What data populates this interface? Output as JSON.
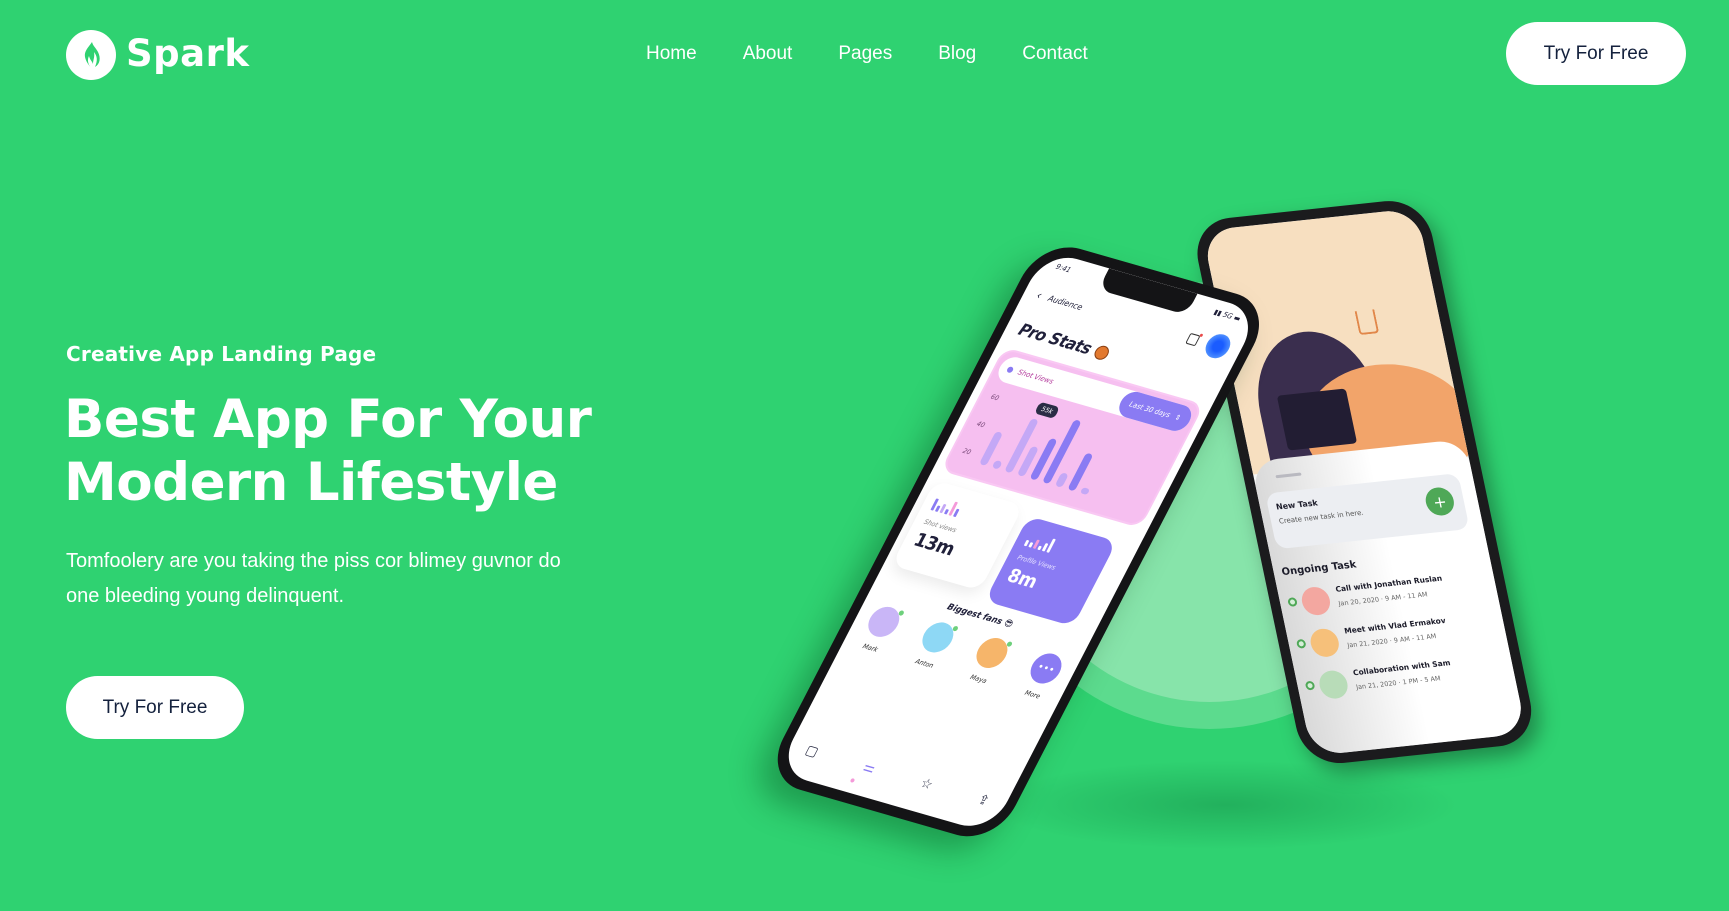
{
  "brand": {
    "name": "Spark",
    "logo_icon": "flame-icon",
    "colors": {
      "background": "#2fd271",
      "halo_outer": "#5cdb8e",
      "halo_inner": "#87e4aa",
      "button_bg": "#ffffff",
      "button_text": "#14213d",
      "accent_purple": "#8a7bf3",
      "chart_pink": "#f6bff0",
      "task_green": "#4fa857"
    }
  },
  "nav": {
    "items": [
      {
        "label": "Home"
      },
      {
        "label": "About"
      },
      {
        "label": "Pages"
      },
      {
        "label": "Blog"
      },
      {
        "label": "Contact"
      }
    ],
    "cta_label": "Try For Free"
  },
  "hero": {
    "eyebrow": "Creative App Landing Page",
    "headline_line1": "Best App For Your",
    "headline_line2": "Modern Lifestyle",
    "lead": "Tomfoolery are you taking the piss cor blimey guvnor do one bleeding young delinquent.",
    "cta_label": "Try For Free"
  },
  "mockup_front": {
    "status_time": "9:41",
    "status_right": "5G",
    "back_icon": "chevron-left-icon",
    "topbar_title": "Audience",
    "calendar_icon": "calendar-icon",
    "page_title": "Pro Stats",
    "title_emoji": "basketball-icon",
    "chart": {
      "label": "Shot Views",
      "range_label": "Last 30 days",
      "range_icon": "updown-chevron-icon",
      "y_ticks": [
        "60",
        "40",
        "20"
      ],
      "tooltip": "55k",
      "bar_values": [
        0.45,
        0.1,
        0.72,
        0.4,
        0.55,
        0.85,
        0.18,
        0.5,
        0.08
      ],
      "bar_light": [
        true,
        true,
        true,
        true,
        false,
        false,
        true,
        false,
        true
      ]
    },
    "stats": [
      {
        "label": "Shot views",
        "value": "13m"
      },
      {
        "label": "Profile Views",
        "value": "8m"
      }
    ],
    "fans_title": "Biggest fans 😎",
    "fans": [
      {
        "name": "Mark",
        "color": "#c9b6f7"
      },
      {
        "name": "Anton",
        "color": "#8ed8f5"
      },
      {
        "name": "Maya",
        "color": "#f6b56a"
      },
      {
        "name": "More",
        "color": "#8a7bf3"
      }
    ],
    "more_glyph": "•••",
    "tabbar_icons": [
      "notes-icon",
      "sliders-icon",
      "star-icon",
      "share-icon"
    ]
  },
  "mockup_back": {
    "new_task_title": "New Task",
    "new_task_sub": "Create new task in here.",
    "add_icon": "plus-icon",
    "ongoing_title": "Ongoing Task",
    "tasks": [
      {
        "name": "Call with Jonathan Ruslan",
        "date": "Jan 20, 2020",
        "time": "9 AM - 11 AM",
        "color": "#f3a7a0"
      },
      {
        "name": "Meet with Vlad Ermakov",
        "date": "Jan 21, 2020",
        "time": "9 AM - 11 AM",
        "color": "#f6c07a"
      },
      {
        "name": "Collaboration with Sam",
        "date": "Jan 21, 2020",
        "time": "1 PM - 5 AM",
        "color": "#b8dcb8"
      }
    ]
  }
}
